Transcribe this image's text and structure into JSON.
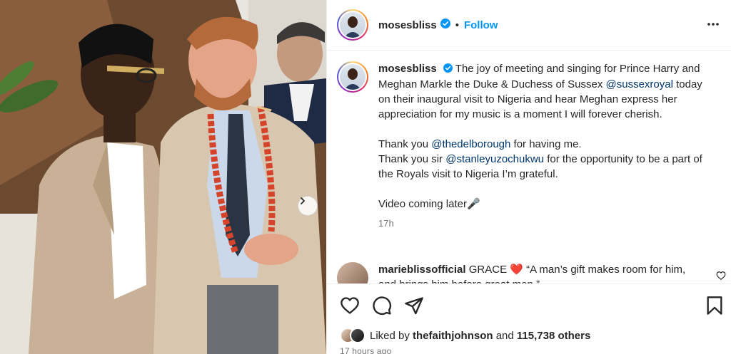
{
  "post": {
    "username": "mosesbliss",
    "separator": "•",
    "follow_label": "Follow",
    "caption_line1_prefix": " The joy of meeting and singing for Prince Harry and Meghan Markle the Duke & Duchess of Sussex ",
    "mention_sussex": "@sussexroyal",
    "caption_line1_suffix": " today on their inaugural visit to Nigeria and hear Meghan express her appreciation for my music is a moment I will forever cherish.",
    "thanks1_prefix": "Thank you ",
    "mention_delborough": "@thedelborough",
    "thanks1_suffix": " for having me.",
    "thanks2_prefix": "Thank you sir ",
    "mention_stanley": "@stanleyuzochukwu",
    "thanks2_suffix": " for the opportunity to be a part of the Royals visit to Nigeria I’m grateful.",
    "video_line": "Video coming later🎤",
    "time_ago": "17h"
  },
  "comment": {
    "username": "marieblissofficial",
    "text": " GRACE ❤️ “A man’s gift makes room for him, and brings him before great men.”"
  },
  "likes": {
    "prefix": "Liked by ",
    "user": "thefaithjohnson",
    "middle": " and ",
    "count": "115,738 others"
  },
  "date": "17 hours ago",
  "icons": {
    "verified": "verified-badge-icon",
    "more": "more-horizontal-icon",
    "like": "heart-icon",
    "comment": "comment-bubble-icon",
    "share": "paper-plane-icon",
    "save": "bookmark-icon",
    "next": "chevron-right-icon"
  },
  "colors": {
    "link": "#0095f6",
    "mention": "#00376b",
    "heart": "#ed4956"
  }
}
